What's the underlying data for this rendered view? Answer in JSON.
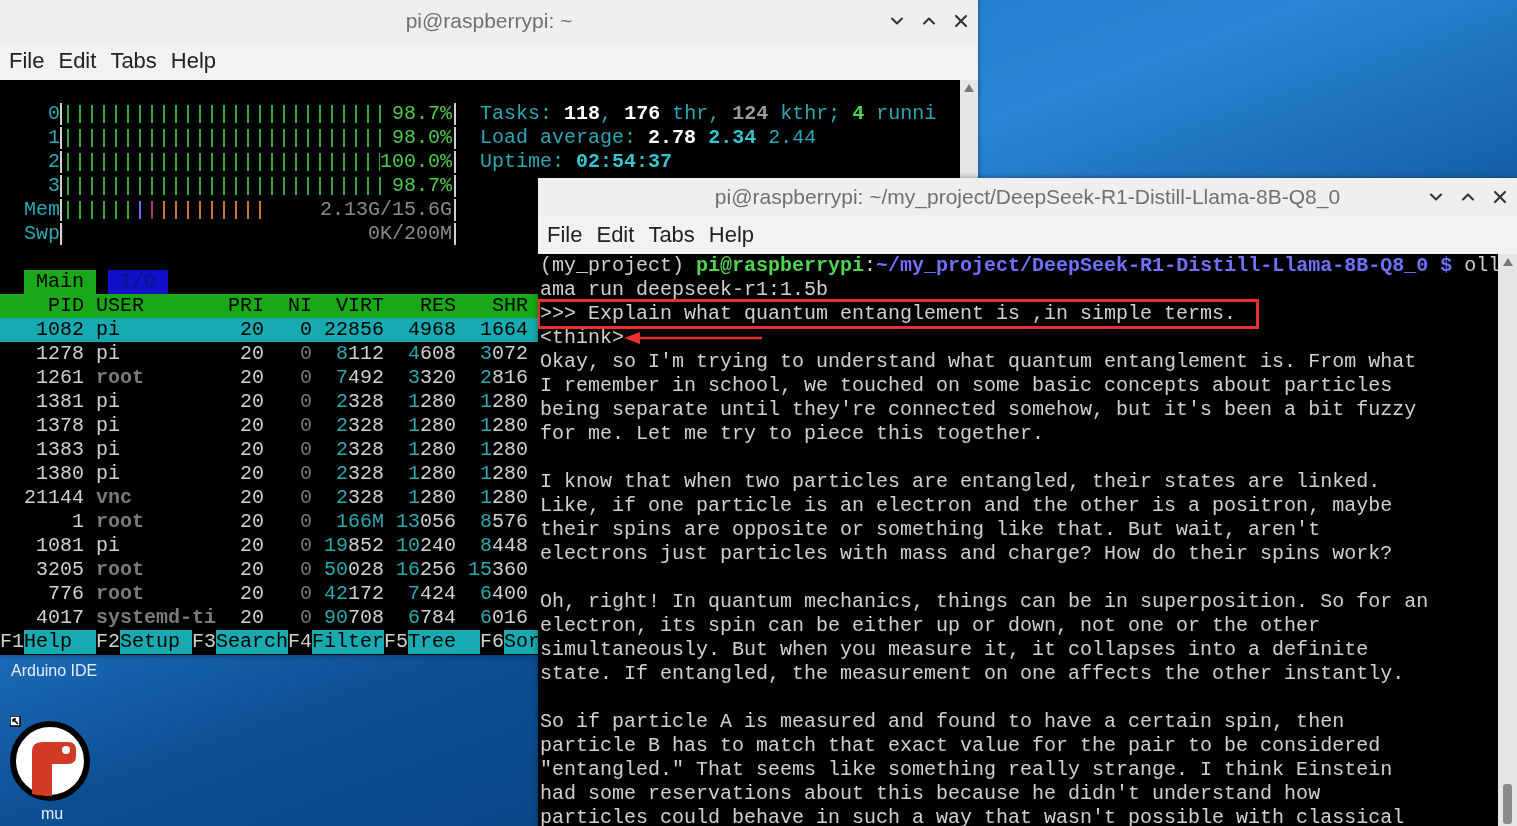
{
  "desktop": {
    "shortcuts": [
      {
        "label": "Arduino IDE",
        "kind": "label"
      },
      {
        "label": "mu",
        "kind": "app"
      }
    ]
  },
  "windows": [
    {
      "title": "pi@raspberrypi: ~",
      "menu": [
        "File",
        "Edit",
        "Tabs",
        "Help"
      ],
      "htop": {
        "cpu_meters": [
          {
            "label": "0",
            "level": 0.987,
            "reading": "98.7%"
          },
          {
            "label": "1",
            "level": 0.98,
            "reading": "98.0%"
          },
          {
            "label": "2",
            "level": 1,
            "reading": "100.0%"
          },
          {
            "label": "3",
            "level": 0.987,
            "reading": "98.7%"
          }
        ],
        "mem_meter": {
          "label": "Mem",
          "reading": "2.13G/15.6G",
          "level": 0.77
        },
        "swap_meter": {
          "label": "Swp",
          "level": 0,
          "reading": "0K/200M"
        },
        "summary": [
          [
            {
              "text": "Tasks: ",
              "kind": "label"
            },
            {
              "text": "118",
              "kind": "value"
            },
            {
              "text": ", ",
              "kind": "label"
            },
            {
              "text": "176",
              "kind": "value"
            },
            {
              "text": " thr, ",
              "kind": "label"
            },
            {
              "text": "124",
              "kind": "dim"
            },
            {
              "text": " kthr; ",
              "kind": "label"
            },
            {
              "text": "4",
              "kind": "running"
            },
            {
              "text": " runni",
              "kind": "label"
            }
          ],
          [
            {
              "text": "Load average: ",
              "kind": "label"
            },
            {
              "text": "2.78",
              "kind": "value"
            },
            {
              "text": " 2.34",
              "kind": "accent"
            },
            {
              "text": " 2.44",
              "kind": "label"
            }
          ],
          [
            {
              "text": "Uptime: ",
              "kind": "label"
            },
            {
              "text": "02:54:37",
              "kind": "accent"
            }
          ]
        ],
        "tabs": [
          {
            "label": "Main",
            "selected": true
          },
          {
            "label": "I/O",
            "selected": false
          }
        ],
        "columns": [
          "PID",
          "USER",
          "PRI",
          "NI",
          "VIRT",
          "RES",
          "SHR"
        ],
        "rows": [
          {
            "cells": [
              "1082",
              "pi",
              "20",
              "0",
              "22856",
              "4968",
              "1664"
            ],
            "selected": true,
            "dimmed": false
          },
          {
            "cells": [
              "1278",
              "pi",
              "20",
              "0",
              "8112",
              "4608",
              "3072"
            ],
            "selected": false,
            "dimmed": false
          },
          {
            "cells": [
              "1261",
              "root",
              "20",
              "0",
              "7492",
              "3320",
              "2816"
            ],
            "selected": false,
            "dimmed": true
          },
          {
            "cells": [
              "1381",
              "pi",
              "20",
              "0",
              "2328",
              "1280",
              "1280"
            ],
            "selected": false,
            "dimmed": false
          },
          {
            "cells": [
              "1378",
              "pi",
              "20",
              "0",
              "2328",
              "1280",
              "1280"
            ],
            "selected": false,
            "dimmed": false
          },
          {
            "cells": [
              "1383",
              "pi",
              "20",
              "0",
              "2328",
              "1280",
              "1280"
            ],
            "selected": false,
            "dimmed": false
          },
          {
            "cells": [
              "1380",
              "pi",
              "20",
              "0",
              "2328",
              "1280",
              "1280"
            ],
            "selected": false,
            "dimmed": false
          },
          {
            "cells": [
              "21144",
              "vnc",
              "20",
              "0",
              "2328",
              "1280",
              "1280"
            ],
            "selected": false,
            "dimmed": true
          },
          {
            "cells": [
              "1",
              "root",
              "20",
              "0",
              "166M",
              "13056",
              "8576"
            ],
            "selected": false,
            "dimmed": true
          },
          {
            "cells": [
              "1081",
              "pi",
              "20",
              "0",
              "19852",
              "10240",
              "8448"
            ],
            "selected": false,
            "dimmed": false
          },
          {
            "cells": [
              "3205",
              "root",
              "20",
              "0",
              "50028",
              "16256",
              "15360"
            ],
            "selected": false,
            "dimmed": true
          },
          {
            "cells": [
              "776",
              "root",
              "20",
              "0",
              "42172",
              "7424",
              "6400"
            ],
            "selected": false,
            "dimmed": true
          },
          {
            "cells": [
              "4017",
              "systemd-ti",
              "20",
              "0",
              "90708",
              "6784",
              "6016"
            ],
            "selected": false,
            "dimmed": true
          }
        ],
        "function_keys": [
          {
            "key": "F1",
            "label": "Help"
          },
          {
            "key": "F2",
            "label": "Setup"
          },
          {
            "key": "F3",
            "label": "Search"
          },
          {
            "key": "F4",
            "label": "Filter"
          },
          {
            "key": "F5",
            "label": "Tree"
          },
          {
            "key": "F6",
            "label": "Sor"
          }
        ]
      }
    },
    {
      "title": "pi@raspberrypi: ~/my_project/DeepSeek-R1-Distill-Llama-8B-Q8_0",
      "menu": [
        "File",
        "Edit",
        "Tabs",
        "Help"
      ],
      "terminal": {
        "prompt": [
          {
            "text": "(my_project) ",
            "kind": "plain"
          },
          {
            "text": "pi@raspberrypi",
            "kind": "user"
          },
          {
            "text": ":",
            "kind": "plain"
          },
          {
            "text": "~/my_project/DeepSeek-R1-Distill-Llama-8B-Q8_0 $",
            "kind": "path"
          },
          {
            "text": " oll",
            "kind": "plain"
          }
        ],
        "lines": [
          {
            "text": "ama run deepseek-r1:1.5b",
            "highlighted": false
          },
          {
            "text": ">>> Explain what quantum entanglement is ,in simple terms.",
            "highlighted": true
          },
          {
            "text": "<think>",
            "highlighted": false
          }
        ],
        "paragraphs": [
          [
            "Okay, so I'm trying to understand what quantum entanglement is. From what",
            "I remember in school, we touched on some basic concepts about particles",
            "being separate until they're connected somehow, but it's been a bit fuzzy",
            "for me. Let me try to piece this together."
          ],
          [
            "I know that when two particles are entangled, their states are linked.",
            "Like, if one particle is an electron and the other is a positron, maybe",
            "their spins are opposite or something like that. But wait, aren't",
            "electrons just particles with mass and charge? How do their spins work?"
          ],
          [
            "Oh, right! In quantum mechanics, things can be in superposition. So for an",
            "electron, its spin can be either up or down, not one or the other",
            "simultaneously. But when you measure it, it collapses into a definite",
            "state. If entangled, the measurement on one affects the other instantly."
          ],
          [
            "So if particle A is measured and found to have a certain spin, then",
            "particle B has to match that exact value for the pair to be considered",
            "\"entangled.\" That seems like something really strange. I think Einstein",
            "had some reservations about this because he didn't understand how",
            "particles could behave in such a way that wasn't possible with classical"
          ]
        ]
      }
    }
  ]
}
